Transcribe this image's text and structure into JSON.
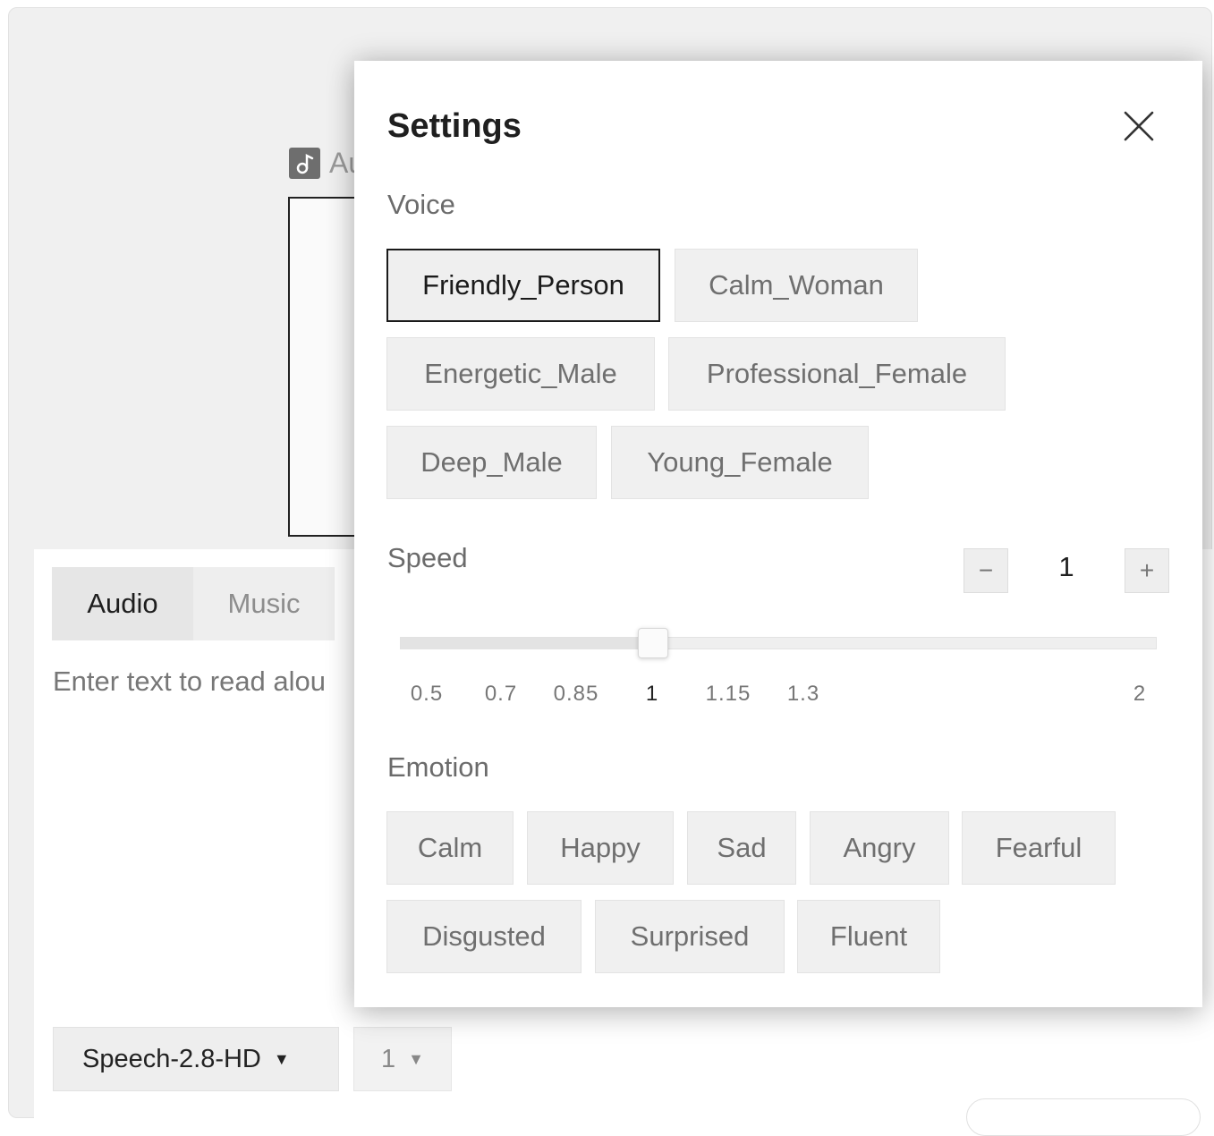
{
  "background": {
    "audio_label": "Au",
    "tabs": [
      "Audio",
      "Music"
    ],
    "active_tab": "Audio",
    "text_placeholder": "Enter text to read alou",
    "model_select": "Speech-2.8-HD",
    "count_select": "1",
    "caret": "▼"
  },
  "settings": {
    "title": "Settings",
    "voice": {
      "label": "Voice",
      "options": [
        "Friendly_Person",
        "Calm_Woman",
        "Energetic_Male",
        "Professional_Female",
        "Deep_Male",
        "Young_Female"
      ],
      "selected": "Friendly_Person"
    },
    "speed": {
      "label": "Speed",
      "value": "1",
      "minus": "−",
      "plus": "+",
      "ticks": [
        "0.5",
        "0.7",
        "0.85",
        "1",
        "1.15",
        "1.3",
        "2"
      ],
      "min": 0.5,
      "max": 2,
      "current": 1
    },
    "emotion": {
      "label": "Emotion",
      "options": [
        "Calm",
        "Happy",
        "Sad",
        "Angry",
        "Fearful",
        "Disgusted",
        "Surprised",
        "Fluent"
      ]
    }
  },
  "colors": {
    "selected_border": "#1a1a1a",
    "chip_bg": "#f0f0f0",
    "chip_text": "#6f6f6f"
  }
}
